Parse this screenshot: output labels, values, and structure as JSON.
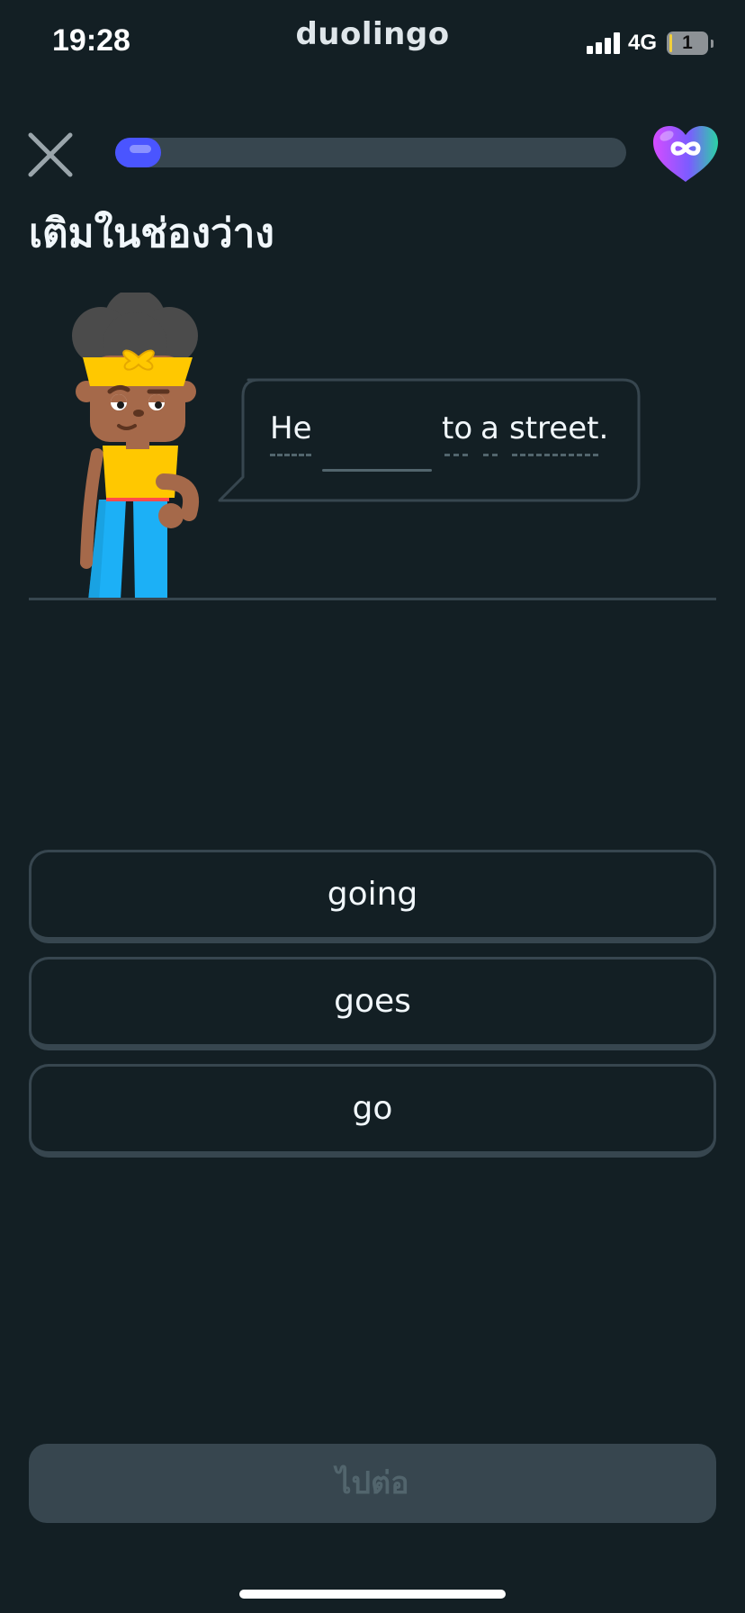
{
  "status_bar": {
    "time": "19:28",
    "app_name": "duolingo",
    "network": "4G",
    "battery_label": "1"
  },
  "header": {
    "close_icon": "close-icon",
    "progress_fraction": 0.09,
    "hearts_icon": "infinity-heart-icon",
    "hearts_colors": [
      "#d54cff",
      "#2bd3a4"
    ]
  },
  "exercise": {
    "instruction": "เติมในช่องว่าง",
    "sentence": {
      "before": "He",
      "after": [
        "to",
        "a",
        "street."
      ]
    }
  },
  "options": [
    {
      "label": "going"
    },
    {
      "label": "goes"
    },
    {
      "label": "go"
    }
  ],
  "footer": {
    "continue_label": "ไปต่อ"
  },
  "colors": {
    "background": "#131f24",
    "border": "#37464f",
    "progress": "#4a55ff",
    "muted": "#52656d"
  }
}
